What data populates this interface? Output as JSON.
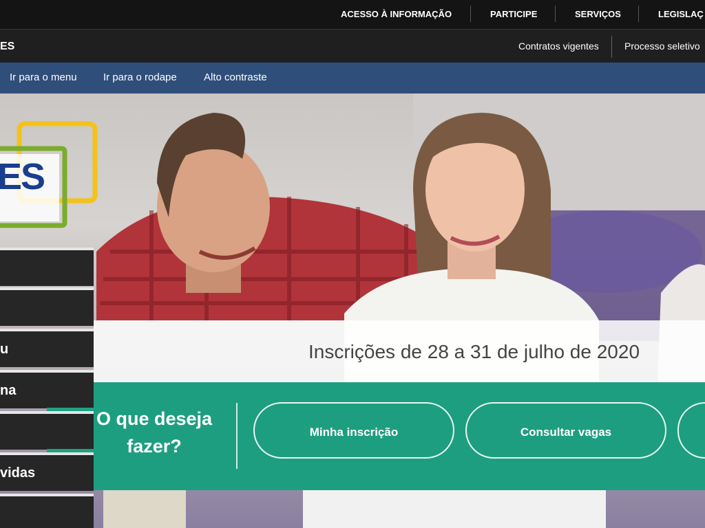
{
  "gov_bar": {
    "links": [
      {
        "label": "ACESSO À INFORMAÇÃO"
      },
      {
        "label": "PARTICIPE"
      },
      {
        "label": "SERVIÇOS"
      },
      {
        "label": "LEGISLAÇ"
      }
    ]
  },
  "site_bar": {
    "name": "ES",
    "links": [
      {
        "label": "Contratos vigentes"
      },
      {
        "label": "Processo seletivo"
      }
    ]
  },
  "accessibility_bar": {
    "links": [
      {
        "label": "Ir para o menu"
      },
      {
        "label": "Ir para o rodape"
      },
      {
        "label": "Alto contraste"
      }
    ]
  },
  "logo": {
    "text": "ES"
  },
  "side_menu": {
    "items": [
      {
        "label": ""
      },
      {
        "label": ""
      },
      {
        "label": "u"
      },
      {
        "label": "na"
      },
      {
        "label": ""
      },
      {
        "label": "vidas"
      },
      {
        "label": ""
      }
    ]
  },
  "hero": {
    "inscricoes": "Inscrições de 28 a 31 de julho de 2020",
    "action_title_line1": "O que deseja",
    "action_title_line2": "fazer?",
    "buttons": [
      {
        "label": "Minha inscrição"
      },
      {
        "label": "Consultar vagas"
      },
      {
        "label": ""
      }
    ]
  },
  "colors": {
    "gov_bar": "#141414",
    "accessibility_bar": "#2f4e7a",
    "action_green": "#1e9e80",
    "logo_yellow": "#f3c21b",
    "logo_green": "#7cab2e",
    "logo_blue": "#1a3d8f"
  }
}
